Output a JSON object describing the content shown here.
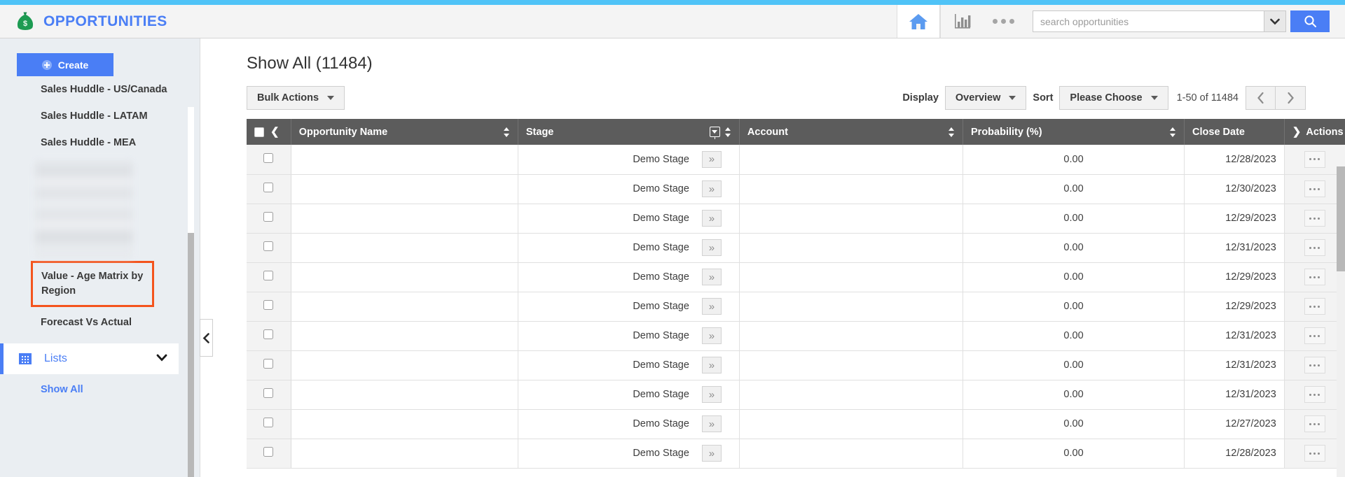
{
  "header": {
    "brand_title": "OPPORTUNITIES",
    "logo_icon": "money-bag-icon",
    "home_icon": "home-icon",
    "reports_icon": "bar-chart-icon",
    "more_icon": "ellipsis-icon",
    "search_placeholder": "search opportunities",
    "search_value": "",
    "search_dropdown_icon": "chevron-down-icon",
    "search_button_icon": "magnifier-icon"
  },
  "sidebar": {
    "create_label": "Create",
    "links": [
      "Sales Huddle - US/Canada",
      "Sales Huddle - LATAM",
      "Sales Huddle - MEA"
    ],
    "highlight_label": "Value - Age Matrix by Region",
    "forecast_label": "Forecast Vs Actual",
    "lists_label": "Lists",
    "lists_icon": "calendar-icon",
    "lists_chevron": "chevron-down-icon",
    "show_all_label": "Show All",
    "collapse_icon": "chevron-left-icon",
    "highlight_color": "#f4541d",
    "accent_color": "#4a7ef5"
  },
  "main": {
    "page_title": "Show All (11484)",
    "bulk_actions_label": "Bulk Actions",
    "display_label": "Display",
    "display_value": "Overview",
    "sort_label": "Sort",
    "sort_value": "Please Choose",
    "range_text": "1-50 of 11484",
    "prev_icon": "chevron-left-icon",
    "next_icon": "chevron-right-icon"
  },
  "table": {
    "columns": [
      {
        "label": "Opportunity Name",
        "sortable": true
      },
      {
        "label": "Stage",
        "sortable": true,
        "filterable": true
      },
      {
        "label": "Account",
        "sortable": true
      },
      {
        "label": "Probability (%)",
        "sortable": true
      },
      {
        "label": "Close Date",
        "sortable": false
      },
      {
        "label": "Actions",
        "sortable": false
      }
    ],
    "header_checkbox_icon": "checkbox-icon",
    "header_collapse_icon": "chevron-left-icon",
    "actions_expand_icon": "chevron-right-icon",
    "rows": [
      {
        "name": "",
        "stage": "Demo Stage",
        "account": "",
        "probability": "0.00",
        "close_date": "12/28/2023"
      },
      {
        "name": "",
        "stage": "Demo Stage",
        "account": "",
        "probability": "0.00",
        "close_date": "12/30/2023"
      },
      {
        "name": "",
        "stage": "Demo Stage",
        "account": "",
        "probability": "0.00",
        "close_date": "12/29/2023"
      },
      {
        "name": "",
        "stage": "Demo Stage",
        "account": "",
        "probability": "0.00",
        "close_date": "12/31/2023"
      },
      {
        "name": "",
        "stage": "Demo Stage",
        "account": "",
        "probability": "0.00",
        "close_date": "12/29/2023"
      },
      {
        "name": "",
        "stage": "Demo Stage",
        "account": "",
        "probability": "0.00",
        "close_date": "12/29/2023"
      },
      {
        "name": "",
        "stage": "Demo Stage",
        "account": "",
        "probability": "0.00",
        "close_date": "12/31/2023"
      },
      {
        "name": "",
        "stage": "Demo Stage",
        "account": "",
        "probability": "0.00",
        "close_date": "12/31/2023"
      },
      {
        "name": "",
        "stage": "Demo Stage",
        "account": "",
        "probability": "0.00",
        "close_date": "12/31/2023"
      },
      {
        "name": "",
        "stage": "Demo Stage",
        "account": "",
        "probability": "0.00",
        "close_date": "12/27/2023"
      },
      {
        "name": "",
        "stage": "Demo Stage",
        "account": "",
        "probability": "0.00",
        "close_date": "12/28/2023"
      }
    ],
    "row_expand_icon": "double-chevron-right-icon",
    "row_actions_icon": "ellipsis-icon"
  }
}
